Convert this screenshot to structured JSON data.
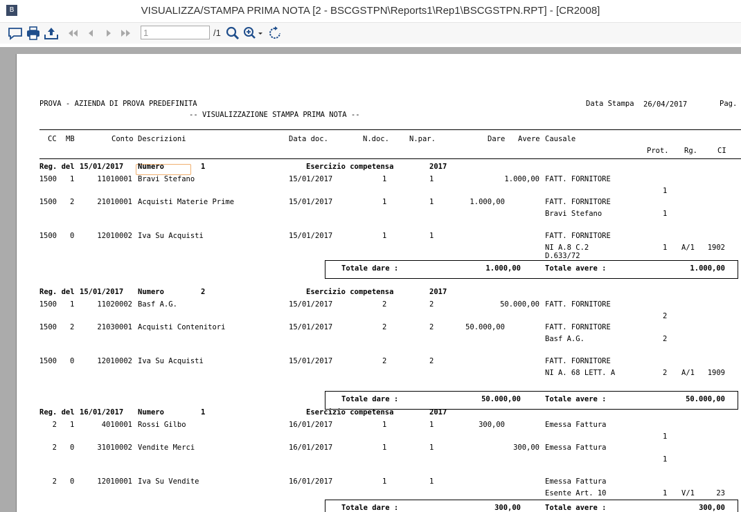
{
  "window": {
    "title": "VISUALIZZA/STAMPA PRIMA NOTA [2 - BSCGSTPN\\Reports1\\Rep1\\BSCGSTPN.RPT] - [CR2008]",
    "icon": "crystal-reports-icon"
  },
  "toolbar": {
    "page_value": "1",
    "page_total": "/1",
    "icons": [
      "export-comment-icon",
      "print-icon",
      "export-icon",
      "first-page-icon",
      "prev-page-icon",
      "next-page-icon",
      "last-page-icon",
      "search-icon",
      "zoom-icon",
      "refresh-icon"
    ]
  },
  "report": {
    "company": "PROVA - AZIENDA DI PROVA PREDEFINITA",
    "subtitle": "-- VISUALIZZAZIONE STAMPA PRIMA NOTA --",
    "print_date_label": "Data Stampa",
    "print_date": "26/04/2017",
    "page_label": "Pag.",
    "headers": {
      "cc": "CC",
      "mb": "MB",
      "conto": "Conto",
      "descr": "Descrizioni",
      "datadoc": "Data doc.",
      "ndoc": "N.doc.",
      "npar": "N.par.",
      "dare": "Dare",
      "avere": "Avere",
      "causale": "Causale",
      "prot": "Prot.",
      "rg": "Rg.",
      "ci": "CI"
    },
    "labels": {
      "reg_del": "Reg. del",
      "numero": "Numero",
      "esercizio": "Esercizio competensa",
      "totale_dare": "Totale dare :",
      "totale_avere": "Totale avere :"
    },
    "blocks": [
      {
        "date": "15/01/2017",
        "numero": "1",
        "esercizio": "2017",
        "rows": [
          {
            "cc": "1500",
            "mb": "1",
            "conto": "11010001",
            "descr": "Bravi Stefano",
            "data": "15/01/2017",
            "ndoc": "1",
            "npar": "1",
            "dare": "",
            "avere": "1.000,00",
            "causale": "FATT. FORNITORE",
            "extra": "",
            "prot": "1",
            "rg": "",
            "ci": ""
          },
          {
            "cc": "1500",
            "mb": "2",
            "conto": "21010001",
            "descr": "Acquisti Materie Prime",
            "data": "15/01/2017",
            "ndoc": "1",
            "npar": "1",
            "dare": "1.000,00",
            "avere": "",
            "causale": "FATT. FORNITORE",
            "extra": "Bravi Stefano",
            "prot": "1",
            "rg": "",
            "ci": ""
          },
          {
            "cc": "1500",
            "mb": "0",
            "conto": "12010002",
            "descr": "Iva Su Acquisti",
            "data": "15/01/2017",
            "ndoc": "1",
            "npar": "1",
            "dare": "",
            "avere": "",
            "causale": "FATT. FORNITORE",
            "extra": "NI A.8 C.2",
            "extra2": "D.633/72",
            "prot": "1",
            "rg": "A/1",
            "ci": "1902"
          }
        ],
        "tot_dare": "1.000,00",
        "tot_avere": "1.000,00"
      },
      {
        "date": "15/01/2017",
        "numero": "2",
        "esercizio": "2017",
        "rows": [
          {
            "cc": "1500",
            "mb": "1",
            "conto": "11020002",
            "descr": "Basf A.G.",
            "data": "15/01/2017",
            "ndoc": "2",
            "npar": "2",
            "dare": "",
            "avere": "50.000,00",
            "causale": "FATT. FORNITORE",
            "extra": "",
            "prot": "2",
            "rg": "",
            "ci": ""
          },
          {
            "cc": "1500",
            "mb": "2",
            "conto": "21030001",
            "descr": "Acquisti Contenitori",
            "data": "15/01/2017",
            "ndoc": "2",
            "npar": "2",
            "dare": "50.000,00",
            "avere": "",
            "causale": "FATT. FORNITORE",
            "extra": "Basf A.G.",
            "prot": "2",
            "rg": "",
            "ci": ""
          },
          {
            "cc": "1500",
            "mb": "0",
            "conto": "12010002",
            "descr": "Iva Su Acquisti",
            "data": "15/01/2017",
            "ndoc": "2",
            "npar": "2",
            "dare": "",
            "avere": "",
            "causale": "FATT. FORNITORE",
            "extra": "NI A. 68 LETT. A",
            "prot": "2",
            "rg": "A/1",
            "ci": "1909"
          }
        ],
        "tot_dare": "50.000,00",
        "tot_avere": "50.000,00"
      },
      {
        "date": "16/01/2017",
        "numero": "1",
        "esercizio": "2017",
        "rows": [
          {
            "cc": "2",
            "mb": "1",
            "conto": "4010001",
            "descr": "Rossi Gilbo",
            "data": "16/01/2017",
            "ndoc": "1",
            "npar": "1",
            "dare": "300,00",
            "avere": "",
            "causale": "Emessa Fattura",
            "extra": "",
            "prot": "1",
            "rg": "",
            "ci": ""
          },
          {
            "cc": "2",
            "mb": "0",
            "conto": "31010002",
            "descr": "Vendite Merci",
            "data": "16/01/2017",
            "ndoc": "1",
            "npar": "1",
            "dare": "",
            "avere": "300,00",
            "causale": "Emessa Fattura",
            "extra": "",
            "prot": "1",
            "rg": "",
            "ci": ""
          },
          {
            "cc": "2",
            "mb": "0",
            "conto": "12010001",
            "descr": "Iva Su Vendite",
            "data": "16/01/2017",
            "ndoc": "1",
            "npar": "1",
            "dare": "",
            "avere": "",
            "causale": "Emessa Fattura",
            "extra": "Esente Art. 10",
            "prot": "1",
            "rg": "V/1",
            "ci": "23"
          }
        ],
        "tot_dare": "300,00",
        "tot_avere": "300,00"
      }
    ]
  }
}
